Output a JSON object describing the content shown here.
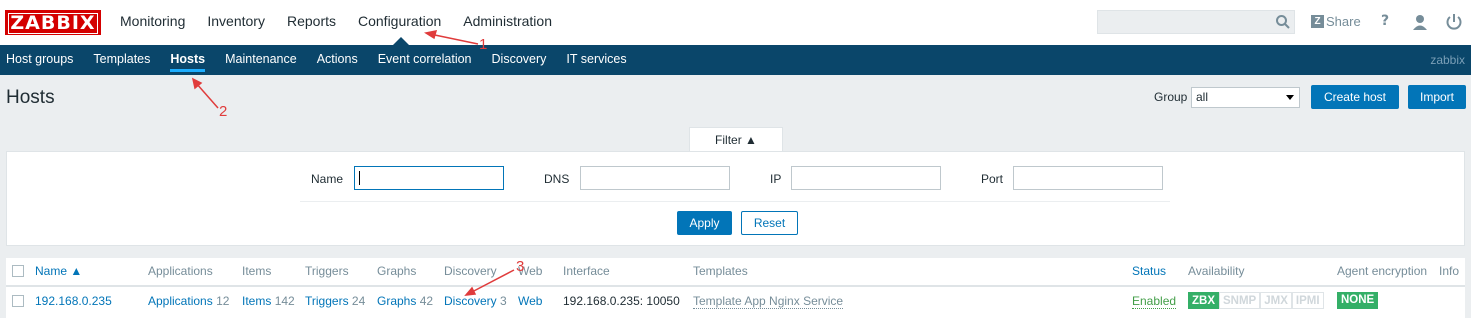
{
  "logo": "ZABBIX",
  "main_menu": [
    "Monitoring",
    "Inventory",
    "Reports",
    "Configuration",
    "Administration"
  ],
  "top_right": {
    "share_label": "Share",
    "help": "?"
  },
  "sub_menu": [
    "Host groups",
    "Templates",
    "Hosts",
    "Maintenance",
    "Actions",
    "Event correlation",
    "Discovery",
    "IT services"
  ],
  "user": "zabbix",
  "page": {
    "title": "Hosts",
    "group_label": "Group",
    "group_value": "all",
    "create_host": "Create host",
    "import": "Import"
  },
  "filter": {
    "tab_label": "Filter ▲",
    "name_label": "Name",
    "name_value": "",
    "dns_label": "DNS",
    "dns_value": "",
    "ip_label": "IP",
    "ip_value": "",
    "port_label": "Port",
    "port_value": "",
    "apply": "Apply",
    "reset": "Reset"
  },
  "table": {
    "headers": [
      "Name ▲",
      "Applications",
      "Items",
      "Triggers",
      "Graphs",
      "Discovery",
      "Web",
      "Interface",
      "Templates",
      "Status",
      "Availability",
      "Agent encryption",
      "Info"
    ],
    "row": {
      "name": "192.168.0.235",
      "applications": "Applications",
      "applications_count": "12",
      "items": "Items",
      "items_count": "142",
      "triggers": "Triggers",
      "triggers_count": "24",
      "graphs": "Graphs",
      "graphs_count": "42",
      "discovery": "Discovery",
      "discovery_count": "3",
      "web": "Web",
      "interface": "192.168.0.235: 10050",
      "template": "Template App Nginx Service",
      "status": "Enabled",
      "availability": [
        "ZBX",
        "SNMP",
        "JMX",
        "IPMI"
      ],
      "encryption": "NONE"
    }
  },
  "annotations": [
    "1",
    "2",
    "3"
  ],
  "colors": {
    "brand": "#d40000",
    "nav": "#0a466a",
    "accent": "#0275b8",
    "ok": "#34af67"
  }
}
